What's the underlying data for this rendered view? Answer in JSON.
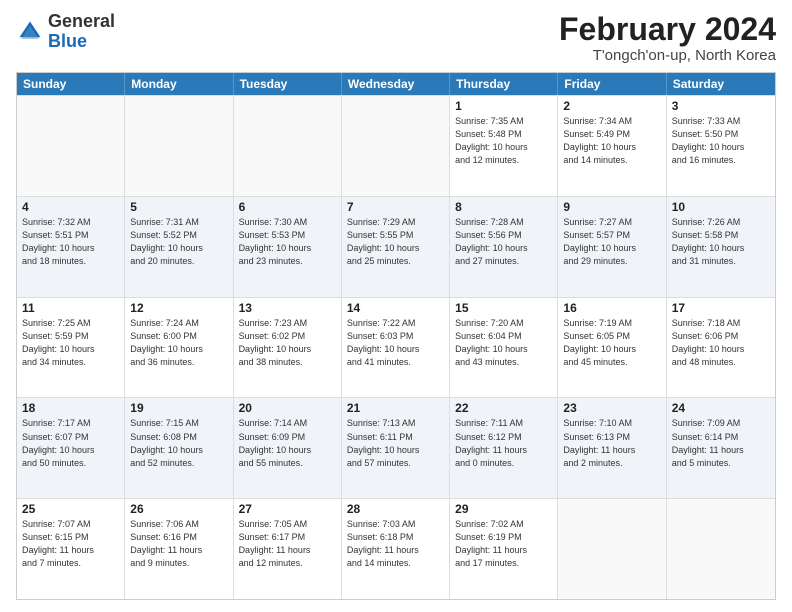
{
  "logo": {
    "general": "General",
    "blue": "Blue"
  },
  "header": {
    "title": "February 2024",
    "subtitle": "T'ongch'on-up, North Korea"
  },
  "weekdays": [
    "Sunday",
    "Monday",
    "Tuesday",
    "Wednesday",
    "Thursday",
    "Friday",
    "Saturday"
  ],
  "weeks": [
    [
      {
        "day": "",
        "info": ""
      },
      {
        "day": "",
        "info": ""
      },
      {
        "day": "",
        "info": ""
      },
      {
        "day": "",
        "info": ""
      },
      {
        "day": "1",
        "info": "Sunrise: 7:35 AM\nSunset: 5:48 PM\nDaylight: 10 hours\nand 12 minutes."
      },
      {
        "day": "2",
        "info": "Sunrise: 7:34 AM\nSunset: 5:49 PM\nDaylight: 10 hours\nand 14 minutes."
      },
      {
        "day": "3",
        "info": "Sunrise: 7:33 AM\nSunset: 5:50 PM\nDaylight: 10 hours\nand 16 minutes."
      }
    ],
    [
      {
        "day": "4",
        "info": "Sunrise: 7:32 AM\nSunset: 5:51 PM\nDaylight: 10 hours\nand 18 minutes."
      },
      {
        "day": "5",
        "info": "Sunrise: 7:31 AM\nSunset: 5:52 PM\nDaylight: 10 hours\nand 20 minutes."
      },
      {
        "day": "6",
        "info": "Sunrise: 7:30 AM\nSunset: 5:53 PM\nDaylight: 10 hours\nand 23 minutes."
      },
      {
        "day": "7",
        "info": "Sunrise: 7:29 AM\nSunset: 5:55 PM\nDaylight: 10 hours\nand 25 minutes."
      },
      {
        "day": "8",
        "info": "Sunrise: 7:28 AM\nSunset: 5:56 PM\nDaylight: 10 hours\nand 27 minutes."
      },
      {
        "day": "9",
        "info": "Sunrise: 7:27 AM\nSunset: 5:57 PM\nDaylight: 10 hours\nand 29 minutes."
      },
      {
        "day": "10",
        "info": "Sunrise: 7:26 AM\nSunset: 5:58 PM\nDaylight: 10 hours\nand 31 minutes."
      }
    ],
    [
      {
        "day": "11",
        "info": "Sunrise: 7:25 AM\nSunset: 5:59 PM\nDaylight: 10 hours\nand 34 minutes."
      },
      {
        "day": "12",
        "info": "Sunrise: 7:24 AM\nSunset: 6:00 PM\nDaylight: 10 hours\nand 36 minutes."
      },
      {
        "day": "13",
        "info": "Sunrise: 7:23 AM\nSunset: 6:02 PM\nDaylight: 10 hours\nand 38 minutes."
      },
      {
        "day": "14",
        "info": "Sunrise: 7:22 AM\nSunset: 6:03 PM\nDaylight: 10 hours\nand 41 minutes."
      },
      {
        "day": "15",
        "info": "Sunrise: 7:20 AM\nSunset: 6:04 PM\nDaylight: 10 hours\nand 43 minutes."
      },
      {
        "day": "16",
        "info": "Sunrise: 7:19 AM\nSunset: 6:05 PM\nDaylight: 10 hours\nand 45 minutes."
      },
      {
        "day": "17",
        "info": "Sunrise: 7:18 AM\nSunset: 6:06 PM\nDaylight: 10 hours\nand 48 minutes."
      }
    ],
    [
      {
        "day": "18",
        "info": "Sunrise: 7:17 AM\nSunset: 6:07 PM\nDaylight: 10 hours\nand 50 minutes."
      },
      {
        "day": "19",
        "info": "Sunrise: 7:15 AM\nSunset: 6:08 PM\nDaylight: 10 hours\nand 52 minutes."
      },
      {
        "day": "20",
        "info": "Sunrise: 7:14 AM\nSunset: 6:09 PM\nDaylight: 10 hours\nand 55 minutes."
      },
      {
        "day": "21",
        "info": "Sunrise: 7:13 AM\nSunset: 6:11 PM\nDaylight: 10 hours\nand 57 minutes."
      },
      {
        "day": "22",
        "info": "Sunrise: 7:11 AM\nSunset: 6:12 PM\nDaylight: 11 hours\nand 0 minutes."
      },
      {
        "day": "23",
        "info": "Sunrise: 7:10 AM\nSunset: 6:13 PM\nDaylight: 11 hours\nand 2 minutes."
      },
      {
        "day": "24",
        "info": "Sunrise: 7:09 AM\nSunset: 6:14 PM\nDaylight: 11 hours\nand 5 minutes."
      }
    ],
    [
      {
        "day": "25",
        "info": "Sunrise: 7:07 AM\nSunset: 6:15 PM\nDaylight: 11 hours\nand 7 minutes."
      },
      {
        "day": "26",
        "info": "Sunrise: 7:06 AM\nSunset: 6:16 PM\nDaylight: 11 hours\nand 9 minutes."
      },
      {
        "day": "27",
        "info": "Sunrise: 7:05 AM\nSunset: 6:17 PM\nDaylight: 11 hours\nand 12 minutes."
      },
      {
        "day": "28",
        "info": "Sunrise: 7:03 AM\nSunset: 6:18 PM\nDaylight: 11 hours\nand 14 minutes."
      },
      {
        "day": "29",
        "info": "Sunrise: 7:02 AM\nSunset: 6:19 PM\nDaylight: 11 hours\nand 17 minutes."
      },
      {
        "day": "",
        "info": ""
      },
      {
        "day": "",
        "info": ""
      }
    ]
  ]
}
